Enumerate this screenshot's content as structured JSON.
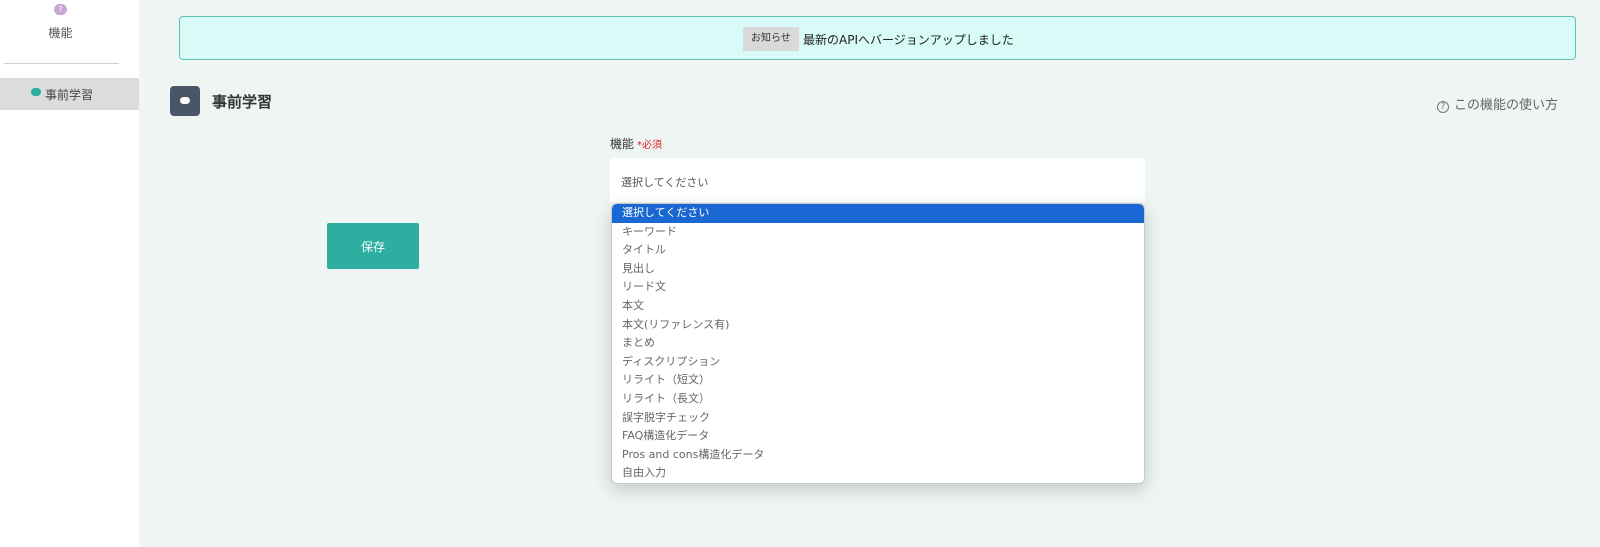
{
  "sidebar": {
    "func_icon_glyph": "?",
    "func_label": "機能",
    "items": [
      {
        "label": "事前学習"
      }
    ]
  },
  "notice": {
    "badge": "お知らせ",
    "text": "最新のAPIへバージョンアップしました"
  },
  "header": {
    "title": "事前学習",
    "help_link": "この機能の使い方",
    "help_icon_glyph": "?"
  },
  "form": {
    "field_label": "機能",
    "required_mark": "*必須",
    "select_value": "選択してください",
    "options": [
      "選択してください",
      "キーワード",
      "タイトル",
      "見出し",
      "リード文",
      "本文",
      "本文(リファレンス有)",
      "まとめ",
      "ディスクリプション",
      "リライト（短文）",
      "リライト（長文）",
      "誤字脱字チェック",
      "FAQ構造化データ",
      "Pros and cons構造化データ",
      "自由入力"
    ],
    "selected_index": 0,
    "save_label": "保存"
  },
  "colors": {
    "accent": "#2eaea0",
    "selected_option": "#1967d2",
    "notice_bg": "#d8fbf8",
    "page_bg": "#eef5f3"
  }
}
